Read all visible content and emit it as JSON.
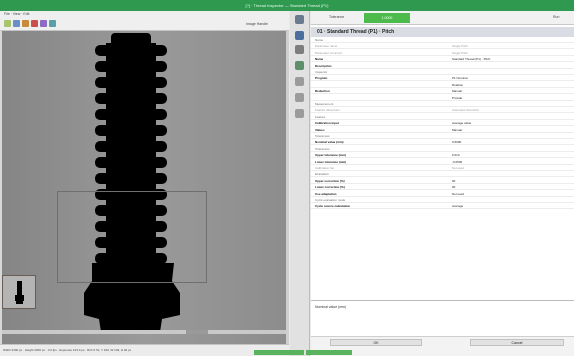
{
  "window": {
    "title": "[?] · Thread Inspector — Standard Thread (P1)"
  },
  "left": {
    "menu_label": "File · View · Edit",
    "zoom_label": "Image Handle",
    "status_text": "Width 2400 px · Height 2000 px · 0.0 fps · Exposure 123.0 μs · ROI X 51, Y 160, W 149, H 92 px"
  },
  "rail": [
    "gear-icon",
    "plus-icon",
    "adjust-icon",
    "measure-icon",
    "list-icon",
    "grid-icon",
    "link-icon"
  ],
  "right": {
    "header_left": "Tolerance",
    "header_chip": "1.0000",
    "header_right": "Run",
    "panel_title": "01 · Standard Thread (P1) · Pitch",
    "properties": [
      {
        "label": "Name",
        "value": "",
        "cls": "group"
      },
      {
        "label": "Parameter name",
        "value": "Single Pitch",
        "cls": "dim"
      },
      {
        "label": "Parameter comment",
        "value": "Single Pitch",
        "cls": "dim"
      },
      {
        "label": "Name",
        "value": "Standard Thread (P1) · Pitch",
        "cls": "boldl"
      },
      {
        "label": "Description",
        "value": "",
        "cls": "boldl"
      },
      {
        "label": "Inspector",
        "value": "",
        "cls": "group"
      },
      {
        "label": "Program",
        "value": "P1 Nominal",
        "cls": "boldl"
      },
      {
        "label": "",
        "value": "Rotation",
        "cls": ""
      },
      {
        "label": "Reduction",
        "value": "Manual",
        "cls": "boldl"
      },
      {
        "label": "",
        "value": "Provide",
        "cls": ""
      },
      {
        "label": "Measurement",
        "value": "",
        "cls": "group"
      },
      {
        "label": "Feature dimension",
        "value": "Automatic threshold",
        "cls": "dim"
      },
      {
        "label": "Feature",
        "value": "",
        "cls": "group"
      },
      {
        "label": "Calibration input",
        "value": "Average value",
        "cls": "boldl"
      },
      {
        "label": "Values",
        "value": "Manual",
        "cls": "boldl"
      },
      {
        "label": "Tolerances",
        "value": "",
        "cls": "group"
      },
      {
        "label": "Nominal value (mm)",
        "value": "0.5000",
        "cls": "boldl"
      },
      {
        "label": "Tolerances",
        "value": "",
        "cls": "group"
      },
      {
        "label": "Upper tolerance (mm)",
        "value": "0.010",
        "cls": "boldl"
      },
      {
        "label": "Lower tolerance (mm)",
        "value": "-0.0500",
        "cls": "boldl"
      },
      {
        "label": "Calibration fac",
        "value": "Not used",
        "cls": "dim"
      },
      {
        "label": "Evaluation",
        "value": "",
        "cls": "group"
      },
      {
        "label": "Upper correction (%)",
        "value": "90",
        "cls": "boldl"
      },
      {
        "label": "Lower correction (%)",
        "value": "90",
        "cls": "boldl"
      },
      {
        "label": "Use adaptation",
        "value": "Not used",
        "cls": "boldl"
      },
      {
        "label": "Cycle evaluation mode",
        "value": "",
        "cls": "group"
      },
      {
        "label": "Cycle source calculation",
        "value": "Average",
        "cls": "boldl"
      }
    ],
    "desc_label": "Nominal value (mm)",
    "ok_label": "OK",
    "cancel_label": "Cancel"
  }
}
